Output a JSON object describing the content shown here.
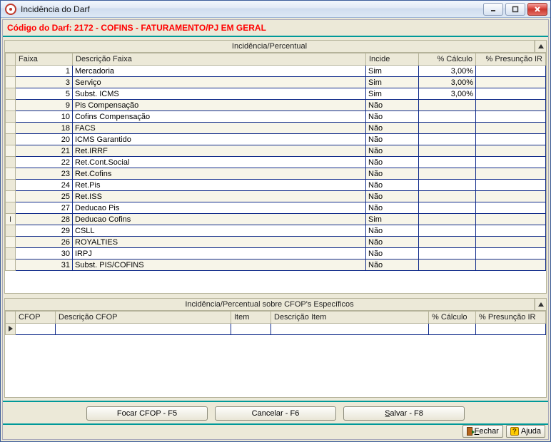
{
  "window": {
    "title": "Incidência do Darf"
  },
  "header": {
    "label": "Código do Darf: 2172 - COFINS - FATURAMENTO/PJ EM GERAL"
  },
  "grid1": {
    "caption": "Incidência/Percentual",
    "columns": {
      "faixa": "Faixa",
      "descricao": "Descrição Faixa",
      "incide": "Incide",
      "calculo": "% Cálculo",
      "presuncao": "% Presunção IR"
    },
    "rows": [
      {
        "faixa": "1",
        "descricao": "Mercadoria",
        "incide": "Sim",
        "calculo": "3,00%",
        "presuncao": "",
        "marker": ""
      },
      {
        "faixa": "3",
        "descricao": "Serviço",
        "incide": "Sim",
        "calculo": "3,00%",
        "presuncao": "",
        "marker": ""
      },
      {
        "faixa": "5",
        "descricao": "Subst. ICMS",
        "incide": "Sim",
        "calculo": "3,00%",
        "presuncao": "",
        "marker": ""
      },
      {
        "faixa": "9",
        "descricao": "Pis Compensação",
        "incide": "Não",
        "calculo": "",
        "presuncao": "",
        "marker": ""
      },
      {
        "faixa": "10",
        "descricao": "Cofins Compensação",
        "incide": "Não",
        "calculo": "",
        "presuncao": "",
        "marker": ""
      },
      {
        "faixa": "18",
        "descricao": "FACS",
        "incide": "Não",
        "calculo": "",
        "presuncao": "",
        "marker": ""
      },
      {
        "faixa": "20",
        "descricao": "ICMS Garantido",
        "incide": "Não",
        "calculo": "",
        "presuncao": "",
        "marker": ""
      },
      {
        "faixa": "21",
        "descricao": "Ret.IRRF",
        "incide": "Não",
        "calculo": "",
        "presuncao": "",
        "marker": ""
      },
      {
        "faixa": "22",
        "descricao": "Ret.Cont.Social",
        "incide": "Não",
        "calculo": "",
        "presuncao": "",
        "marker": ""
      },
      {
        "faixa": "23",
        "descricao": "Ret.Cofins",
        "incide": "Não",
        "calculo": "",
        "presuncao": "",
        "marker": ""
      },
      {
        "faixa": "24",
        "descricao": "Ret.Pis",
        "incide": "Não",
        "calculo": "",
        "presuncao": "",
        "marker": ""
      },
      {
        "faixa": "25",
        "descricao": "Ret.ISS",
        "incide": "Não",
        "calculo": "",
        "presuncao": "",
        "marker": ""
      },
      {
        "faixa": "27",
        "descricao": "Deducao Pis",
        "incide": "Não",
        "calculo": "",
        "presuncao": "",
        "marker": ""
      },
      {
        "faixa": "28",
        "descricao": "Deducao Cofins",
        "incide": "Sim",
        "calculo": "",
        "presuncao": "",
        "marker": "I"
      },
      {
        "faixa": "29",
        "descricao": "CSLL",
        "incide": "Não",
        "calculo": "",
        "presuncao": "",
        "marker": ""
      },
      {
        "faixa": "26",
        "descricao": "ROYALTIES",
        "incide": "Não",
        "calculo": "",
        "presuncao": "",
        "marker": ""
      },
      {
        "faixa": "30",
        "descricao": "IRPJ",
        "incide": "Não",
        "calculo": "",
        "presuncao": "",
        "marker": ""
      },
      {
        "faixa": "31",
        "descricao": "Subst. PIS/COFINS",
        "incide": "Não",
        "calculo": "",
        "presuncao": "",
        "marker": ""
      }
    ]
  },
  "grid2": {
    "caption": "Incidência/Percentual sobre CFOP's Específicos",
    "columns": {
      "cfop": "CFOP",
      "descricao_cfop": "Descrição CFOP",
      "item": "Item",
      "descricao_item": "Descrição Item",
      "calculo": "% Cálculo",
      "presuncao": "% Presunção IR"
    }
  },
  "buttons": {
    "focar": "Focar CFOP - F5",
    "cancelar": "Cancelar - F6",
    "salvar": "Salvar - F8"
  },
  "statusbar": {
    "fechar": "Fechar",
    "ajuda": "Ajuda"
  }
}
